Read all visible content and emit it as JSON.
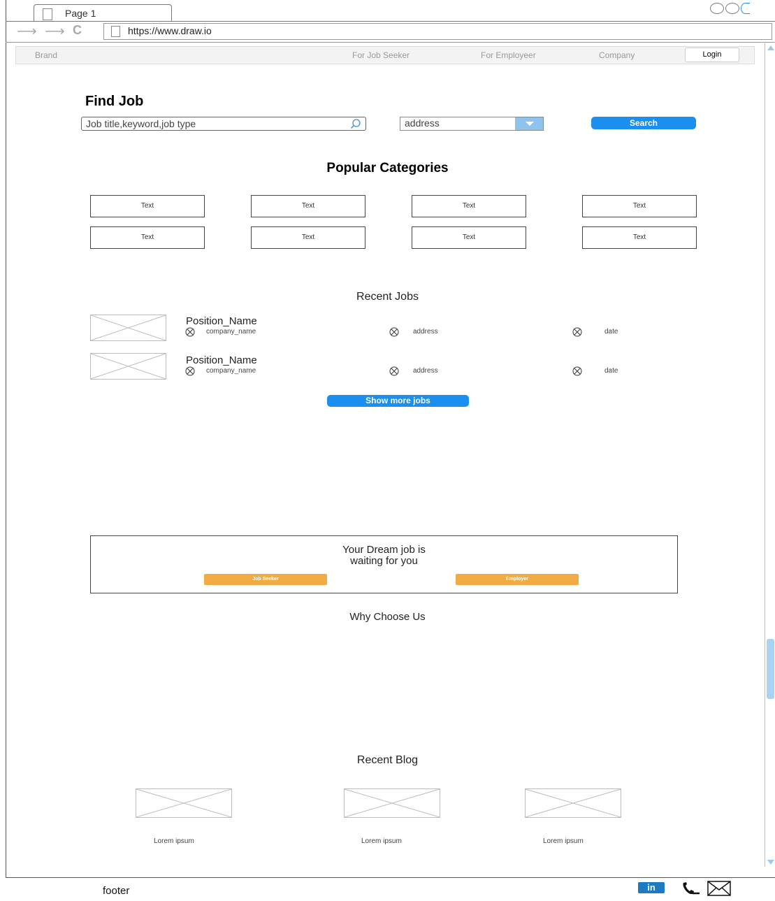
{
  "browser": {
    "tab_title": "Page 1",
    "url": "https://www.draw.io"
  },
  "navbar": {
    "brand": "Brand",
    "links": [
      "For Job Seeker",
      "For Employeer",
      "Company"
    ],
    "login": "Login"
  },
  "find_job": {
    "title": "Find Job",
    "search_placeholder": "Job title,keyword,job type",
    "address_value": "address",
    "search_button": "Search"
  },
  "categories": {
    "title": "Popular Categories",
    "items": [
      "Text",
      "Text",
      "Text",
      "Text",
      "Text",
      "Text",
      "Text",
      "Text"
    ]
  },
  "recent_jobs": {
    "title": "Recent Jobs",
    "jobs": [
      {
        "position": "Position_Name",
        "company": "company_name",
        "address": "address",
        "date": "date"
      },
      {
        "position": "Position_Name",
        "company": "company_name",
        "address": "address",
        "date": "date"
      }
    ],
    "more_button": "Show more jobs"
  },
  "dream": {
    "line1": "Your Dream job is",
    "line2": "waiting for you",
    "job_seeker_button": "Job Seeker",
    "employer_button": "Employer"
  },
  "why_choose": {
    "title": "Why Choose Us"
  },
  "blog": {
    "title": "Recent Blog",
    "items": [
      "Lorem ipsum",
      "Lorem ipsum",
      "Lorem ipsum"
    ]
  },
  "footer": {
    "text": "footer",
    "linkedin": "in"
  },
  "colors": {
    "primary_button": "#1b8ff0",
    "orange_button": "#f0ab44",
    "linkedin": "#1d7bc1"
  },
  "icons": [
    "page-icon",
    "back-arrow-icon",
    "forward-arrow-icon",
    "refresh-icon",
    "search-icon",
    "dropdown-icon",
    "circle-x-icon",
    "image-placeholder-icon",
    "linkedin-icon",
    "phone-icon",
    "mail-icon"
  ]
}
